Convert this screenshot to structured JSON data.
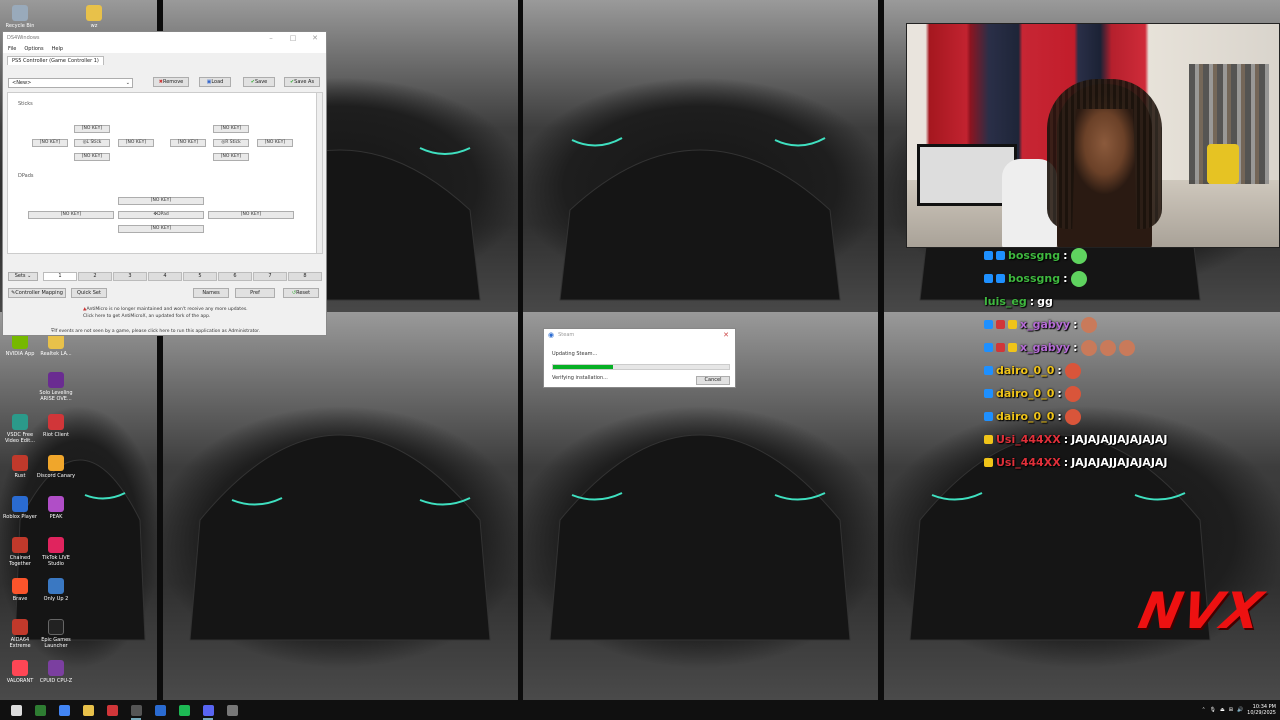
{
  "desktop_icons": [
    {
      "label": "Recycle Bin",
      "color": "#9ab"
    },
    {
      "label": "wz",
      "color": "#e8c14a"
    },
    {
      "label": "NVIDIA App",
      "color": "#76b900"
    },
    {
      "label": "Realtek LA...",
      "color": "#e8c14a"
    },
    {
      "label": "Solo Leveling ARISE OVE...",
      "color": "#6a2c91"
    },
    {
      "label": "VSDC Free Video Edit...",
      "color": "#2b9a8a"
    },
    {
      "label": "Riot Client",
      "color": "#d13639"
    },
    {
      "label": "Rust",
      "color": "#c0392b"
    },
    {
      "label": "Discord Canary",
      "color": "#f0a62b"
    },
    {
      "label": "Roblox Player",
      "color": "#2a6bd1"
    },
    {
      "label": "PEAK",
      "color": "#b04ec7"
    },
    {
      "label": "Chained Together",
      "color": "#c0392b"
    },
    {
      "label": "TikTok LIVE Studio",
      "color": "#e0245e"
    },
    {
      "label": "Brave",
      "color": "#fb542b"
    },
    {
      "label": "Only Up 2",
      "color": "#3a78c2"
    },
    {
      "label": "AIDA64 Extreme",
      "color": "#c0392b"
    },
    {
      "label": "Epic Games Launcher",
      "color": "#222"
    },
    {
      "label": "VALORANT",
      "color": "#ff4655"
    },
    {
      "label": "CPUID CPU-Z",
      "color": "#7b3fa0"
    }
  ],
  "ds4": {
    "title": "DS4Windows",
    "menu": [
      "File",
      "Options",
      "Help"
    ],
    "tab": "PS5 Controller (Game Controller 1)",
    "profile_select": "<New>",
    "buttons": {
      "remove": "Remove",
      "load": "Load",
      "save": "Save",
      "save_as": "Save As"
    },
    "sticks_label": "Sticks",
    "dpads_label": "DPads",
    "no_key": "[NO KEY]",
    "l_stick": "L Stick",
    "r_stick": "R Stick",
    "dpad": "DPad",
    "sets_label": "Sets",
    "set_numbers": [
      "1",
      "2",
      "3",
      "4",
      "5",
      "6",
      "7",
      "8"
    ],
    "controller_mapping": "Controller Mapping",
    "quick_set": "Quick Set",
    "names": "Names",
    "pref": "Pref",
    "reset": "Reset",
    "warning_line1": "AntiMicro is no longer maintained and won't receive any more updates.",
    "warning_line2": "Click here to get AntiMicroX, an updated fork of the app.",
    "admin_note": "If events are not seen by a game, please click here to run this application as Administrator."
  },
  "steam": {
    "title": "Steam",
    "status": "Updating Steam...",
    "progress": 0.34,
    "detail": "Verifying installation...",
    "cancel": "Cancel"
  },
  "chat": [
    {
      "user": "bossgng",
      "msg": "",
      "color": "#3fb83f",
      "badges": [
        "#1e90ff",
        "#1e90ff"
      ],
      "emotes": [
        "#5fd35f"
      ]
    },
    {
      "user": "bossgng",
      "msg": "",
      "color": "#3fb83f",
      "badges": [
        "#1e90ff",
        "#1e90ff"
      ],
      "emotes": [
        "#5fd35f"
      ]
    },
    {
      "user": "luis_eg",
      "msg": "gg",
      "color": "#3fb83f",
      "badges": [],
      "emotes": []
    },
    {
      "user": "x_gabyy",
      "msg": "",
      "color": "#b56bd6",
      "badges": [
        "#1e90ff",
        "#d13639",
        "#f0c419"
      ],
      "emotes": [
        "#c97a5a"
      ]
    },
    {
      "user": "x_gabyy",
      "msg": "",
      "color": "#b56bd6",
      "badges": [
        "#1e90ff",
        "#d13639",
        "#f0c419"
      ],
      "emotes": [
        "#c97a5a",
        "#c97a5a",
        "#c97a5a"
      ]
    },
    {
      "user": "dairo_0_0",
      "msg": "",
      "color": "#f0c419",
      "badges": [
        "#1e90ff"
      ],
      "emotes": [
        "#d9553a"
      ]
    },
    {
      "user": "dairo_0_0",
      "msg": "",
      "color": "#f0c419",
      "badges": [
        "#1e90ff"
      ],
      "emotes": [
        "#d9553a"
      ]
    },
    {
      "user": "dairo_0_0",
      "msg": "",
      "color": "#f0c419",
      "badges": [
        "#1e90ff"
      ],
      "emotes": [
        "#d9553a"
      ]
    },
    {
      "user": "Usi_444XX",
      "msg": "JAJAJAJJAJAJAJAJ",
      "color": "#e0303a",
      "badges": [
        "#f0c419"
      ],
      "emotes": []
    },
    {
      "user": "Usi_444XX",
      "msg": "JAJAJAJJAJAJAJAJ",
      "color": "#e0303a",
      "badges": [
        "#f0c419"
      ],
      "emotes": []
    }
  ],
  "logo": "NVX",
  "taskbar": {
    "apps": [
      {
        "name": "windows-start-icon",
        "color": "#ddd"
      },
      {
        "name": "terminal-icon",
        "color": "#2e7d32"
      },
      {
        "name": "chrome-icon",
        "color": "#4285f4"
      },
      {
        "name": "file-explorer-icon",
        "color": "#e8c14a"
      },
      {
        "name": "media-icon",
        "color": "#d13639"
      },
      {
        "name": "obs-icon",
        "color": "#555"
      },
      {
        "name": "steam-icon",
        "color": "#2a6bd1"
      },
      {
        "name": "spotify-icon",
        "color": "#1db954"
      },
      {
        "name": "discord-icon",
        "color": "#5865f2"
      },
      {
        "name": "game-icon",
        "color": "#777"
      }
    ],
    "time": "10:34 PM",
    "date": "10/29/2025"
  }
}
